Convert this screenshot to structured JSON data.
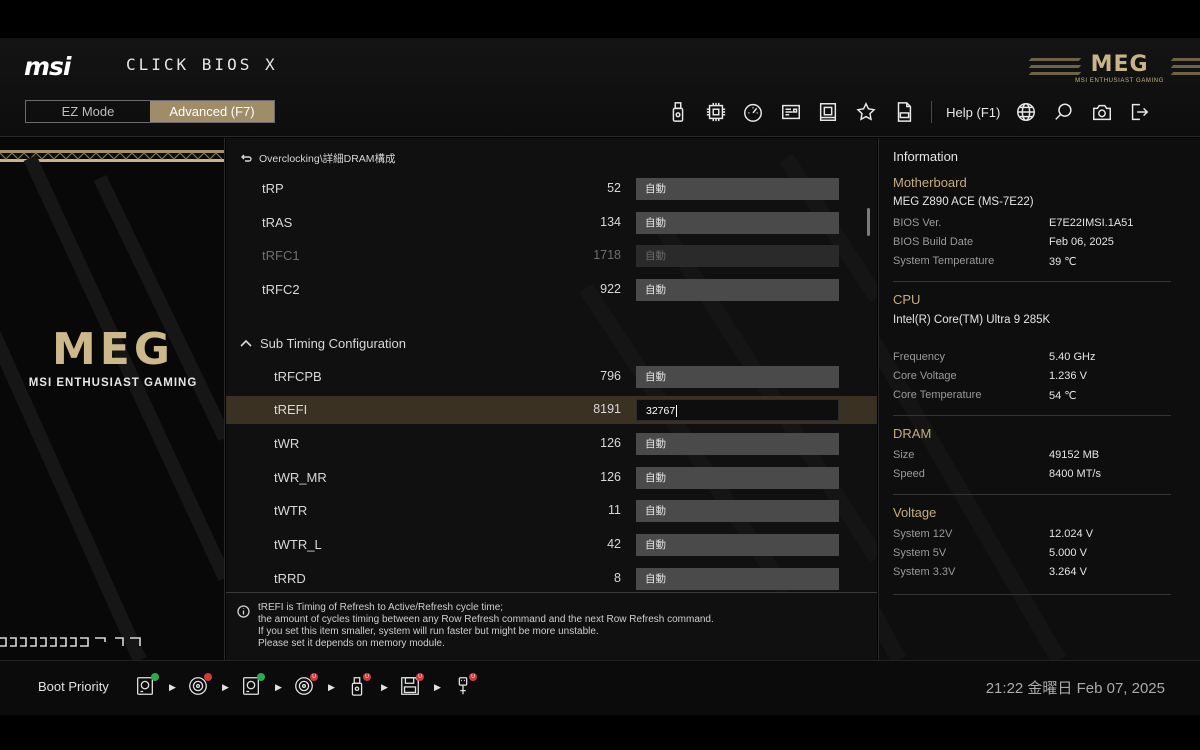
{
  "header": {
    "brand": "msi",
    "product": "CLICK BIOS X",
    "modes": [
      {
        "label": "EZ Mode",
        "active": false
      },
      {
        "label": "Advanced (F7)",
        "active": true
      }
    ],
    "toolbar_icons": [
      "usb-drive-icon",
      "cpu-chip-icon",
      "speedometer-icon",
      "board-explorer-icon",
      "memory-icon",
      "favorite-star-icon",
      "file-icon"
    ],
    "help_label": "Help (F1)",
    "right_icons": [
      "language-globe-icon",
      "search-icon",
      "screenshot-camera-icon",
      "exit-icon"
    ],
    "badge_word": "MEG",
    "badge_sub": "MSI ENTHUSIAST GAMING"
  },
  "left_panel": {
    "logo_word": "MEG",
    "logo_sub": "MSI ENTHUSIAST GAMING"
  },
  "center": {
    "breadcrumb": "Overclocking\\詳細DRAM構成",
    "rows_top": [
      {
        "name": "tRP",
        "value": "52",
        "setting": "自動",
        "disabled": false
      },
      {
        "name": "tRAS",
        "value": "134",
        "setting": "自動",
        "disabled": false
      },
      {
        "name": "tRFC1",
        "value": "1718",
        "setting": "自動",
        "disabled": true
      },
      {
        "name": "tRFC2",
        "value": "922",
        "setting": "自動",
        "disabled": false
      }
    ],
    "section": "Sub Timing Configuration",
    "rows_sub": [
      {
        "name": "tRFCPB",
        "value": "796",
        "setting": "自動",
        "selected": false
      },
      {
        "name": "tREFI",
        "value": "8191",
        "setting": "32767",
        "selected": true
      },
      {
        "name": "tWR",
        "value": "126",
        "setting": "自動",
        "selected": false
      },
      {
        "name": "tWR_MR",
        "value": "126",
        "setting": "自動",
        "selected": false
      },
      {
        "name": "tWTR",
        "value": "11",
        "setting": "自動",
        "selected": false
      },
      {
        "name": "tWTR_L",
        "value": "42",
        "setting": "自動",
        "selected": false
      },
      {
        "name": "tRRD",
        "value": "8",
        "setting": "自動",
        "selected": false
      }
    ],
    "help_lines": [
      "tREFI is Timing of Refresh to Active/Refresh cycle time;",
      "the amount of cycles timing between any Row Refresh command and the next Row Refresh command.",
      "If you set this item smaller, system will run faster but might be more unstable.",
      "Please set it depends on memory module."
    ]
  },
  "info": {
    "title": "Information",
    "motherboard": {
      "heading": "Motherboard",
      "model": "MEG Z890 ACE (MS-7E22)",
      "items": [
        {
          "key": "BIOS Ver.",
          "value": "E7E22IMSI.1A51"
        },
        {
          "key": "BIOS Build Date",
          "value": "Feb 06, 2025"
        },
        {
          "key": "System Temperature",
          "value": "39 ℃"
        }
      ]
    },
    "cpu": {
      "heading": "CPU",
      "model": "Intel(R) Core(TM) Ultra 9 285K",
      "items": [
        {
          "key": "Frequency",
          "value": "5.40 GHz"
        },
        {
          "key": "Core Voltage",
          "value": "1.236 V"
        },
        {
          "key": "Core Temperature",
          "value": "54 ℃"
        }
      ]
    },
    "dram": {
      "heading": "DRAM",
      "items": [
        {
          "key": "Size",
          "value": "49152 MB"
        },
        {
          "key": "Speed",
          "value": "8400 MT/s"
        }
      ]
    },
    "voltage": {
      "heading": "Voltage",
      "items": [
        {
          "key": "System 12V",
          "value": "12.024 V"
        },
        {
          "key": "System 5V",
          "value": "5.000 V"
        },
        {
          "key": "System 3.3V",
          "value": "3.264 V"
        }
      ]
    }
  },
  "footer": {
    "boot_label": "Boot Priority",
    "boot_devices": [
      "hdd-icon",
      "optical-disc-icon",
      "hdd-icon",
      "optical-disc-icon",
      "usb-drive-icon",
      "floppy-icon",
      "usb-key-icon"
    ],
    "badge_colors": [
      "#2fa84f",
      "#d13a3a",
      "#2fa84f",
      "#d13a3a",
      "#d13a3a",
      "#d13a3a",
      "#d13a3a"
    ],
    "badge_glyphs": [
      "",
      "",
      "",
      "U",
      "U",
      "U",
      "U"
    ],
    "datetime": "21:22  金曜日 Feb 07, 2025"
  },
  "colors": {
    "accent_gold": "#c4ac7e",
    "selected_row": "#3a3122",
    "active_mode": "#a08c68"
  }
}
